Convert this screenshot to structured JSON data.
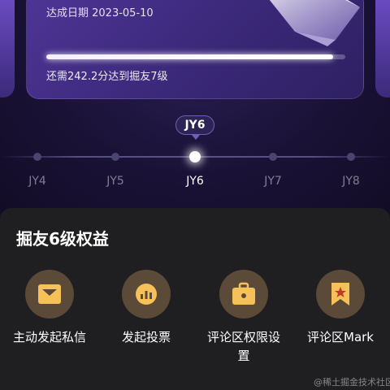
{
  "card": {
    "date_text": "达成日期 2023-05-10",
    "progress": 0.96,
    "need_text": "还需242.2分达到掘友7级"
  },
  "current_level": "JY6",
  "levels": [
    "JY4",
    "JY5",
    "JY6",
    "JY7",
    "JY8"
  ],
  "active_index": 2,
  "benefits": {
    "title": "掘友6级权益",
    "items": [
      {
        "label": "主动发起私信",
        "icon": "envelope-icon"
      },
      {
        "label": "发起投票",
        "icon": "bar-chart-icon"
      },
      {
        "label": "评论区权限设置",
        "icon": "briefcase-icon"
      },
      {
        "label": "评论区Mark",
        "icon": "bookmark-star-icon"
      }
    ]
  },
  "watermark": "@稀土掘金技术社区",
  "colors": {
    "accent_icon": "#f7c15a",
    "icon_bg": "#5a4a37",
    "sheet_bg": "#1f1f21"
  }
}
